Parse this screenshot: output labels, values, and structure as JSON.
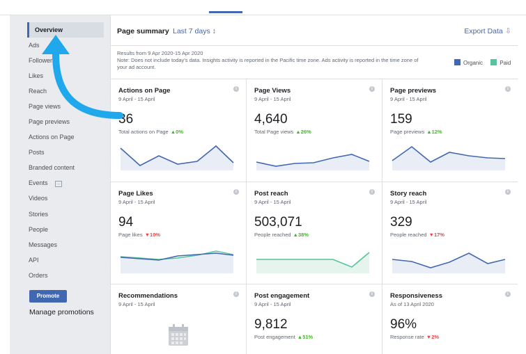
{
  "sidebar": {
    "items": [
      {
        "label": "Overview",
        "active": true
      },
      {
        "label": "Ads"
      },
      {
        "label": "Followers"
      },
      {
        "label": "Likes"
      },
      {
        "label": "Reach"
      },
      {
        "label": "Page views"
      },
      {
        "label": "Page previews"
      },
      {
        "label": "Actions on Page"
      },
      {
        "label": "Posts"
      },
      {
        "label": "Branded content"
      },
      {
        "label": "Events"
      },
      {
        "label": "Videos"
      },
      {
        "label": "Stories"
      },
      {
        "label": "People"
      },
      {
        "label": "Messages"
      },
      {
        "label": "API"
      },
      {
        "label": "Orders"
      }
    ],
    "promote_label": "Promote",
    "manage_label": "Manage promotions"
  },
  "summary": {
    "title": "Page summary",
    "range": "Last 7 days ↕",
    "export_label": "Export Data",
    "results": "Results from 9 Apr 2020-15 Apr 2020",
    "note": "Note: Does not include today's data. Insights activity is reported in the Pacific time zone. Ads activity is reported in the time zone of your ad account.",
    "legend": {
      "organic": "Organic",
      "paid": "Paid"
    }
  },
  "colors": {
    "organic": "#4267b2",
    "paid": "#56c39b",
    "accent": "#4267b2",
    "up": "#42b72a",
    "down": "#fa3e3e"
  },
  "cards": [
    {
      "title": "Actions on Page",
      "date": "9 April - 15 April",
      "value": "36",
      "sub": "Total actions on Page",
      "change": "▲0%",
      "trend": "up"
    },
    {
      "title": "Page Views",
      "date": "9 April - 15 April",
      "value": "4,640",
      "sub": "Total Page views",
      "change": "▲26%",
      "trend": "up"
    },
    {
      "title": "Page previews",
      "date": "9 April - 15 April",
      "value": "159",
      "sub": "Page previews",
      "change": "▲12%",
      "trend": "up"
    },
    {
      "title": "Page Likes",
      "date": "9 April - 15 April",
      "value": "94",
      "sub": "Page likes",
      "change": "▼10%",
      "trend": "down"
    },
    {
      "title": "Post reach",
      "date": "9 April - 15 April",
      "value": "503,071",
      "sub": "People reached",
      "change": "▲38%",
      "trend": "up"
    },
    {
      "title": "Story reach",
      "date": "9 April - 15 April",
      "value": "329",
      "sub": "People reached",
      "change": "▼17%",
      "trend": "down"
    },
    {
      "title": "Recommendations",
      "date": "9 April - 15 April",
      "value": "",
      "sub": "",
      "change": "",
      "trend": ""
    },
    {
      "title": "Post engagement",
      "date": "9 April - 15 April",
      "value": "9,812",
      "sub": "Post engagement",
      "change": "▲51%",
      "trend": "up"
    },
    {
      "title": "Responsiveness",
      "date": "As of 13 April 2020",
      "value": "96%",
      "sub": "Response rate",
      "change": "▼2%",
      "trend": "down"
    }
  ]
}
